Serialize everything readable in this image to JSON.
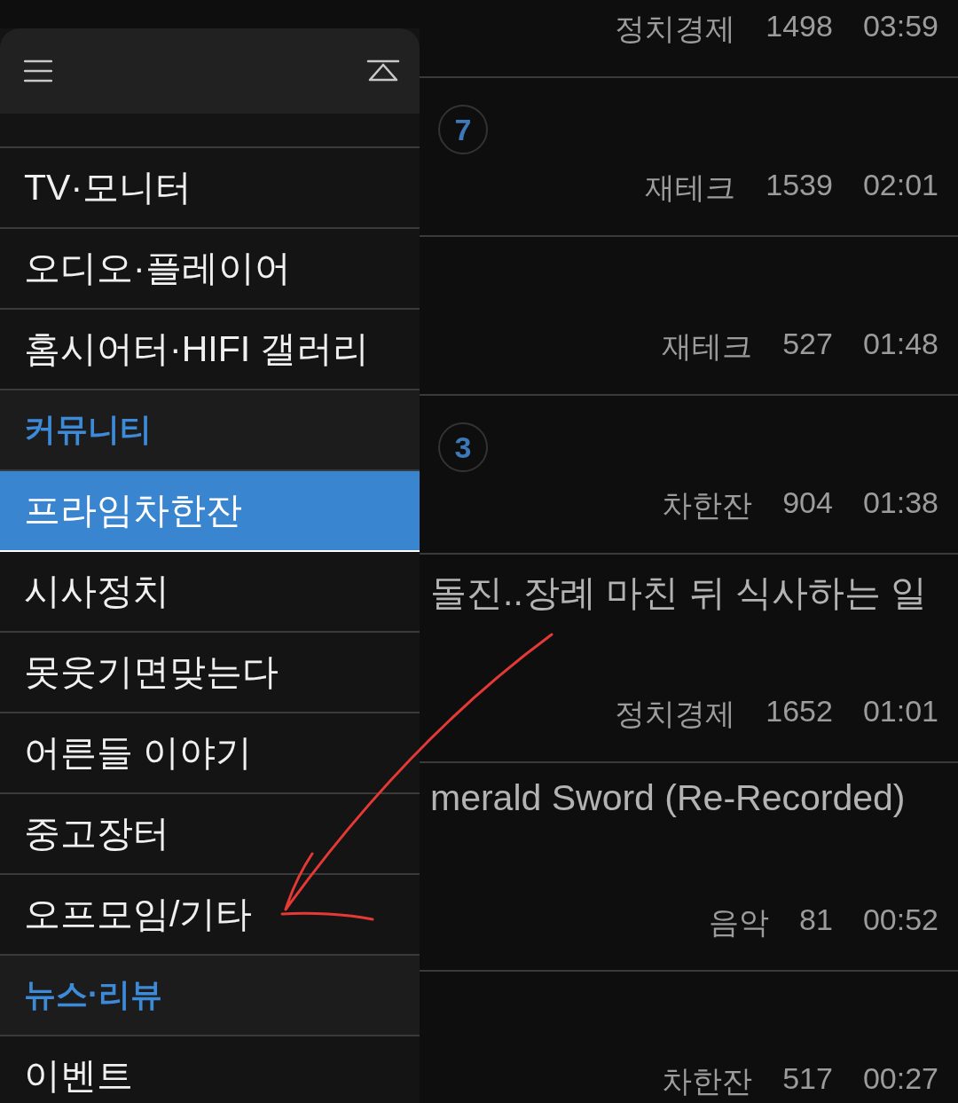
{
  "posts": [
    {
      "category": "정치경제",
      "views": "1498",
      "time": "03:59"
    },
    {
      "badge": "7",
      "category": "재테크",
      "views": "1539",
      "time": "02:01"
    },
    {
      "category": "재테크",
      "views": "527",
      "time": "01:48"
    },
    {
      "badge": "3",
      "category": "차한잔",
      "views": "904",
      "time": "01:38"
    },
    {
      "title": "돌진..장례 마친 뒤 식사하는 일",
      "category": "정치경제",
      "views": "1652",
      "time": "01:01"
    },
    {
      "title": "merald Sword (Re-Recorded)",
      "category": "음악",
      "views": "81",
      "time": "00:52"
    },
    {
      "category": "차한잔",
      "views": "517",
      "time": "00:27"
    }
  ],
  "drawer": {
    "items": [
      {
        "kind": "board",
        "label": "TV·모니터",
        "selected": false
      },
      {
        "kind": "board",
        "label": "오디오·플레이어",
        "selected": false
      },
      {
        "kind": "board",
        "label": "홈시어터·HIFI 갤러리",
        "selected": false
      },
      {
        "kind": "category",
        "label": "커뮤니티"
      },
      {
        "kind": "board",
        "label": "프라임차한잔",
        "selected": true
      },
      {
        "kind": "board",
        "label": "시사정치",
        "selected": false
      },
      {
        "kind": "board",
        "label": "못웃기면맞는다",
        "selected": false
      },
      {
        "kind": "board",
        "label": "어른들 이야기",
        "selected": false
      },
      {
        "kind": "board",
        "label": "중고장터",
        "selected": false
      },
      {
        "kind": "board",
        "label": "오프모임/기타",
        "selected": false
      },
      {
        "kind": "category",
        "label": "뉴스·리뷰"
      },
      {
        "kind": "board",
        "label": "이벤트",
        "selected": false
      }
    ]
  }
}
